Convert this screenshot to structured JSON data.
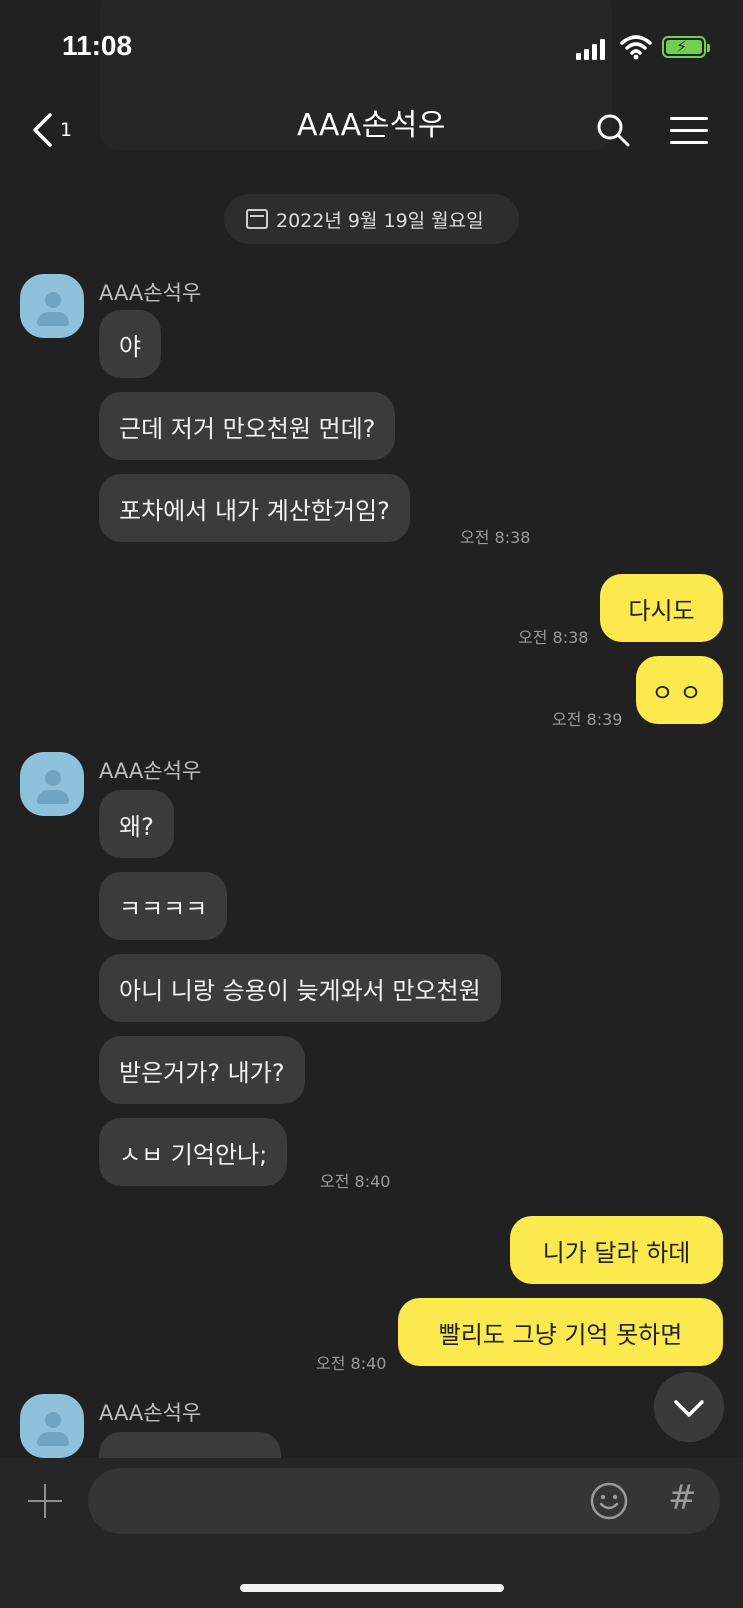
{
  "status_bar": {
    "time": "11:08"
  },
  "header": {
    "back_count": "1",
    "title": "AAA손석우"
  },
  "date_divider": "2022년 9월 19일 월요일",
  "groups": [
    {
      "sender": "AAA손석우",
      "messages": [
        "야",
        "근데 저거 만오천원 먼데?",
        "포차에서 내가 계산한거임?"
      ],
      "time": "오전 8:38"
    },
    {
      "mine": [
        "다시도"
      ],
      "time": "오전 8:38"
    },
    {
      "mine": [
        "ㅇㅇ"
      ],
      "time": "오전 8:39"
    },
    {
      "sender": "AAA손석우",
      "messages": [
        "왜?",
        "ㅋㅋㅋㅋ",
        "아니 니랑 승용이 늦게와서 만오천원",
        "받은거가? 내가?",
        "ㅅㅂ 기억안나;"
      ],
      "time": "오전 8:40"
    },
    {
      "mine": [
        "니가 달라 하데",
        "빨리도 그냥 기억 못하면"
      ],
      "time": "오전 8:40"
    },
    {
      "sender": "AAA손석우"
    }
  ],
  "input": {
    "placeholder": ""
  },
  "icons": {
    "back": "chevron-left-icon",
    "search": "search-icon",
    "menu": "menu-icon",
    "calendar": "calendar-icon",
    "scroll_down": "chevron-down-icon",
    "plus": "plus-icon",
    "emoji": "emoji-icon",
    "hash": "hash-icon"
  },
  "colors": {
    "background": "#212121",
    "incoming_bubble": "#3b3b3b",
    "outgoing_bubble": "#fce94d",
    "avatar": "#8dc1dc",
    "battery": "#6fd14f"
  }
}
